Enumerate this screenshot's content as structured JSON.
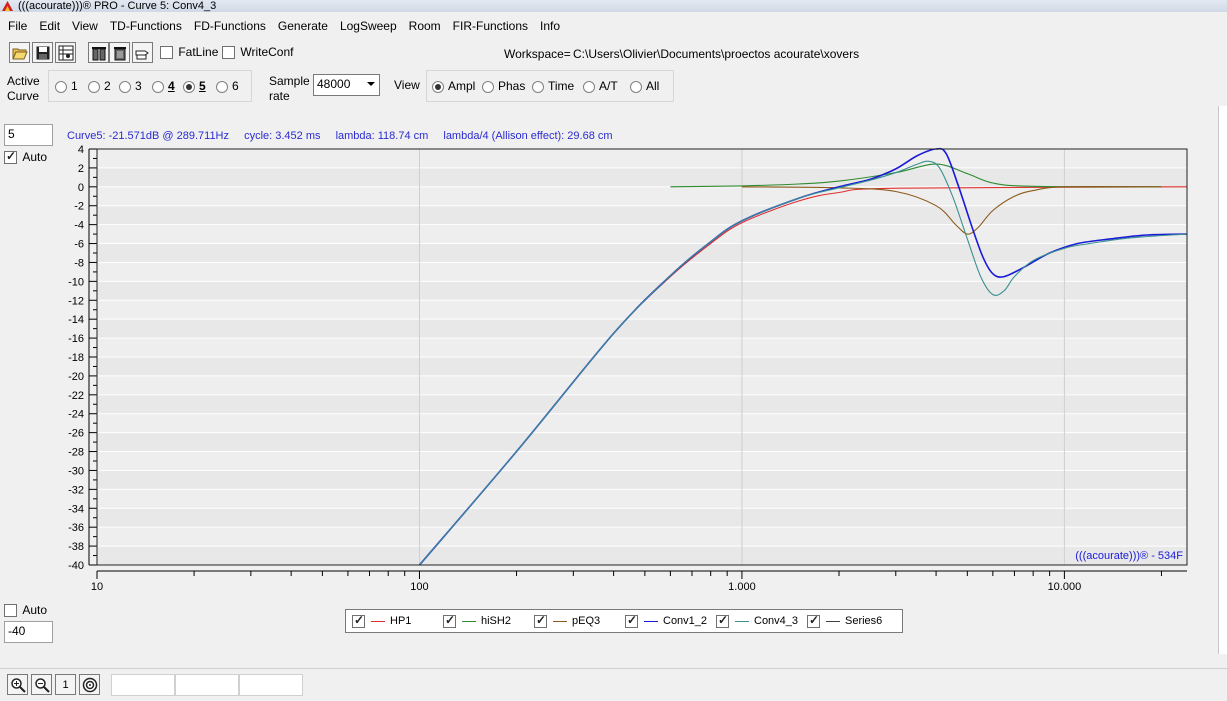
{
  "window": {
    "title": "(((acourate)))® PRO - Curve 5: Conv4_3"
  },
  "menu": [
    "File",
    "Edit",
    "View",
    "TD-Functions",
    "FD-Functions",
    "Generate",
    "LogSweep",
    "Room",
    "FIR-Functions",
    "Info"
  ],
  "toolbar": {
    "fatline_label": "FatLine",
    "writeconf_label": "WriteConf",
    "workspace_label": "Workspace=",
    "workspace_path": "C:\\Users\\Olivier\\Documents\\proectos acourate\\xovers"
  },
  "controls": {
    "active_curve_label_1": "Active",
    "active_curve_label_2": "Curve",
    "curves": [
      {
        "label": "1",
        "bold": false,
        "selected": false
      },
      {
        "label": "2",
        "bold": false,
        "selected": false
      },
      {
        "label": "3",
        "bold": false,
        "selected": false
      },
      {
        "label": "4",
        "bold": true,
        "selected": false
      },
      {
        "label": "5",
        "bold": true,
        "selected": true
      },
      {
        "label": "6",
        "bold": false,
        "selected": false
      }
    ],
    "sample_rate_label_1": "Sample",
    "sample_rate_label_2": "rate",
    "sample_rate_value": "48000",
    "view_label": "View",
    "views": [
      {
        "label": "Ampl",
        "selected": true
      },
      {
        "label": "Phas",
        "selected": false
      },
      {
        "label": "Time",
        "selected": false
      },
      {
        "label": "A/T",
        "selected": false
      },
      {
        "label": "All",
        "selected": false
      }
    ]
  },
  "left_panel": {
    "top_value": "5",
    "top_auto_label": "Auto",
    "top_auto_checked": true,
    "bottom_auto_label": "Auto",
    "bottom_auto_checked": false,
    "bottom_value": "-40"
  },
  "info": {
    "curve": "Curve5:  -21.571dB @ 289.711Hz",
    "cycle": "cycle: 3.452 ms",
    "lambda": "lambda: 118.74 cm",
    "allison": "lambda/4 (Allison effect): 29.68 cm"
  },
  "chart_data": {
    "type": "line",
    "xscale": "log",
    "xlim": [
      10,
      24000
    ],
    "ylim": [
      -40,
      4
    ],
    "x_tick_labels": [
      {
        "value": 10,
        "label": "10"
      },
      {
        "value": 100,
        "label": "100"
      },
      {
        "value": 1000,
        "label": "1.000"
      },
      {
        "value": 10000,
        "label": "10.000"
      }
    ],
    "y_ticks": [
      4,
      2,
      0,
      -2,
      -4,
      -6,
      -8,
      -10,
      -12,
      -14,
      -16,
      -18,
      -20,
      -22,
      -24,
      -26,
      -28,
      -30,
      -32,
      -34,
      -36,
      -38,
      -40
    ],
    "grid": true,
    "watermark": "(((acourate)))® - 534F",
    "legend_position": "bottom-center",
    "series": [
      {
        "name": "HP1",
        "color": "#e03030",
        "checked": true,
        "points": [
          [
            100,
            -40
          ],
          [
            200,
            -28
          ],
          [
            400,
            -15.5
          ],
          [
            600,
            -9.5
          ],
          [
            800,
            -6
          ],
          [
            1000,
            -3.8
          ],
          [
            1500,
            -1.5
          ],
          [
            2000,
            -0.6
          ],
          [
            3000,
            -0.15
          ],
          [
            24000,
            0
          ]
        ]
      },
      {
        "name": "hiSH2",
        "color": "#2e8b2e",
        "checked": true,
        "points": [
          [
            600,
            0
          ],
          [
            1000,
            0.1
          ],
          [
            1500,
            0.3
          ],
          [
            2000,
            0.6
          ],
          [
            3000,
            1.5
          ],
          [
            4000,
            2.4
          ],
          [
            5000,
            1.4
          ],
          [
            6000,
            0.4
          ],
          [
            8000,
            0.05
          ],
          [
            20000,
            0
          ]
        ]
      },
      {
        "name": "pEQ3",
        "color": "#8b5a1a",
        "checked": true,
        "points": [
          [
            1000,
            0
          ],
          [
            2000,
            -0.1
          ],
          [
            3000,
            -0.5
          ],
          [
            4000,
            -2
          ],
          [
            4600,
            -4
          ],
          [
            5000,
            -5
          ],
          [
            5400,
            -4.3
          ],
          [
            6000,
            -2.5
          ],
          [
            7000,
            -1
          ],
          [
            8000,
            -0.4
          ],
          [
            10000,
            0
          ],
          [
            20000,
            0
          ]
        ]
      },
      {
        "name": "Conv1_2",
        "color": "#1a1ad8",
        "checked": true,
        "points": [
          [
            100,
            -40
          ],
          [
            200,
            -28
          ],
          [
            400,
            -15.5
          ],
          [
            600,
            -9.4
          ],
          [
            800,
            -5.8
          ],
          [
            1000,
            -3.6
          ],
          [
            1500,
            -1.2
          ],
          [
            2000,
            0
          ],
          [
            2500,
            0.8
          ],
          [
            3000,
            1.9
          ],
          [
            3500,
            3.3
          ],
          [
            4000,
            4.4
          ],
          [
            4300,
            3.5
          ],
          [
            4700,
            0
          ],
          [
            5200,
            -4.5
          ],
          [
            5600,
            -7.5
          ],
          [
            6000,
            -9.2
          ],
          [
            6500,
            -9.5
          ],
          [
            7500,
            -8.5
          ],
          [
            9000,
            -7
          ],
          [
            11000,
            -6
          ],
          [
            14000,
            -5.5
          ],
          [
            18000,
            -5.1
          ],
          [
            24000,
            -5
          ]
        ]
      },
      {
        "name": "Conv4_3",
        "color": "#3a9090",
        "checked": true,
        "points": [
          [
            100,
            -40
          ],
          [
            200,
            -28
          ],
          [
            400,
            -15.5
          ],
          [
            600,
            -9.4
          ],
          [
            800,
            -5.8
          ],
          [
            1000,
            -3.6
          ],
          [
            1500,
            -1.2
          ],
          [
            2000,
            -0.1
          ],
          [
            2500,
            0.7
          ],
          [
            3000,
            1.5
          ],
          [
            3500,
            2.4
          ],
          [
            3800,
            2.7
          ],
          [
            4100,
            2
          ],
          [
            4500,
            -1
          ],
          [
            5000,
            -5.5
          ],
          [
            5500,
            -9.5
          ],
          [
            6000,
            -11.4
          ],
          [
            6500,
            -11
          ],
          [
            7000,
            -9.5
          ],
          [
            8000,
            -7.8
          ],
          [
            10000,
            -6.5
          ],
          [
            12000,
            -6
          ],
          [
            16000,
            -5.4
          ],
          [
            24000,
            -5
          ]
        ]
      },
      {
        "name": "Series6",
        "color": "#404040",
        "checked": true,
        "points": []
      }
    ]
  }
}
